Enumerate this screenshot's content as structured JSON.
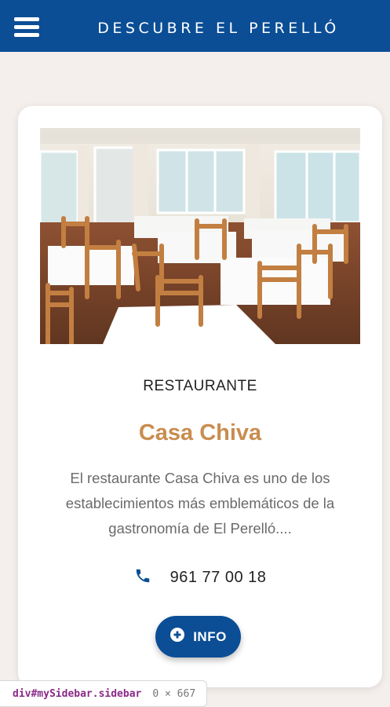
{
  "header": {
    "title": "DESCUBRE EL PERELLÓ",
    "menu_icon": "hamburger-menu-icon"
  },
  "card": {
    "category": "RESTAURANTE",
    "name": "Casa Chiva",
    "description": "El restaurante Casa Chiva es uno de los establecimientos más emblemáticos de la gastronomía de El Perelló....",
    "phone": "961 77 00 18",
    "phone_icon": "phone-icon",
    "info_button": {
      "label": "INFO",
      "icon": "plus-circle-icon"
    },
    "photo_alt": "restaurant dining room"
  },
  "devtools": {
    "selector": "div#mySidebar.sidebar",
    "size": "0 × 667"
  },
  "colors": {
    "brand_blue": "#0b4e96",
    "accent_brown": "#c98d4f",
    "background": "#f4efec"
  }
}
